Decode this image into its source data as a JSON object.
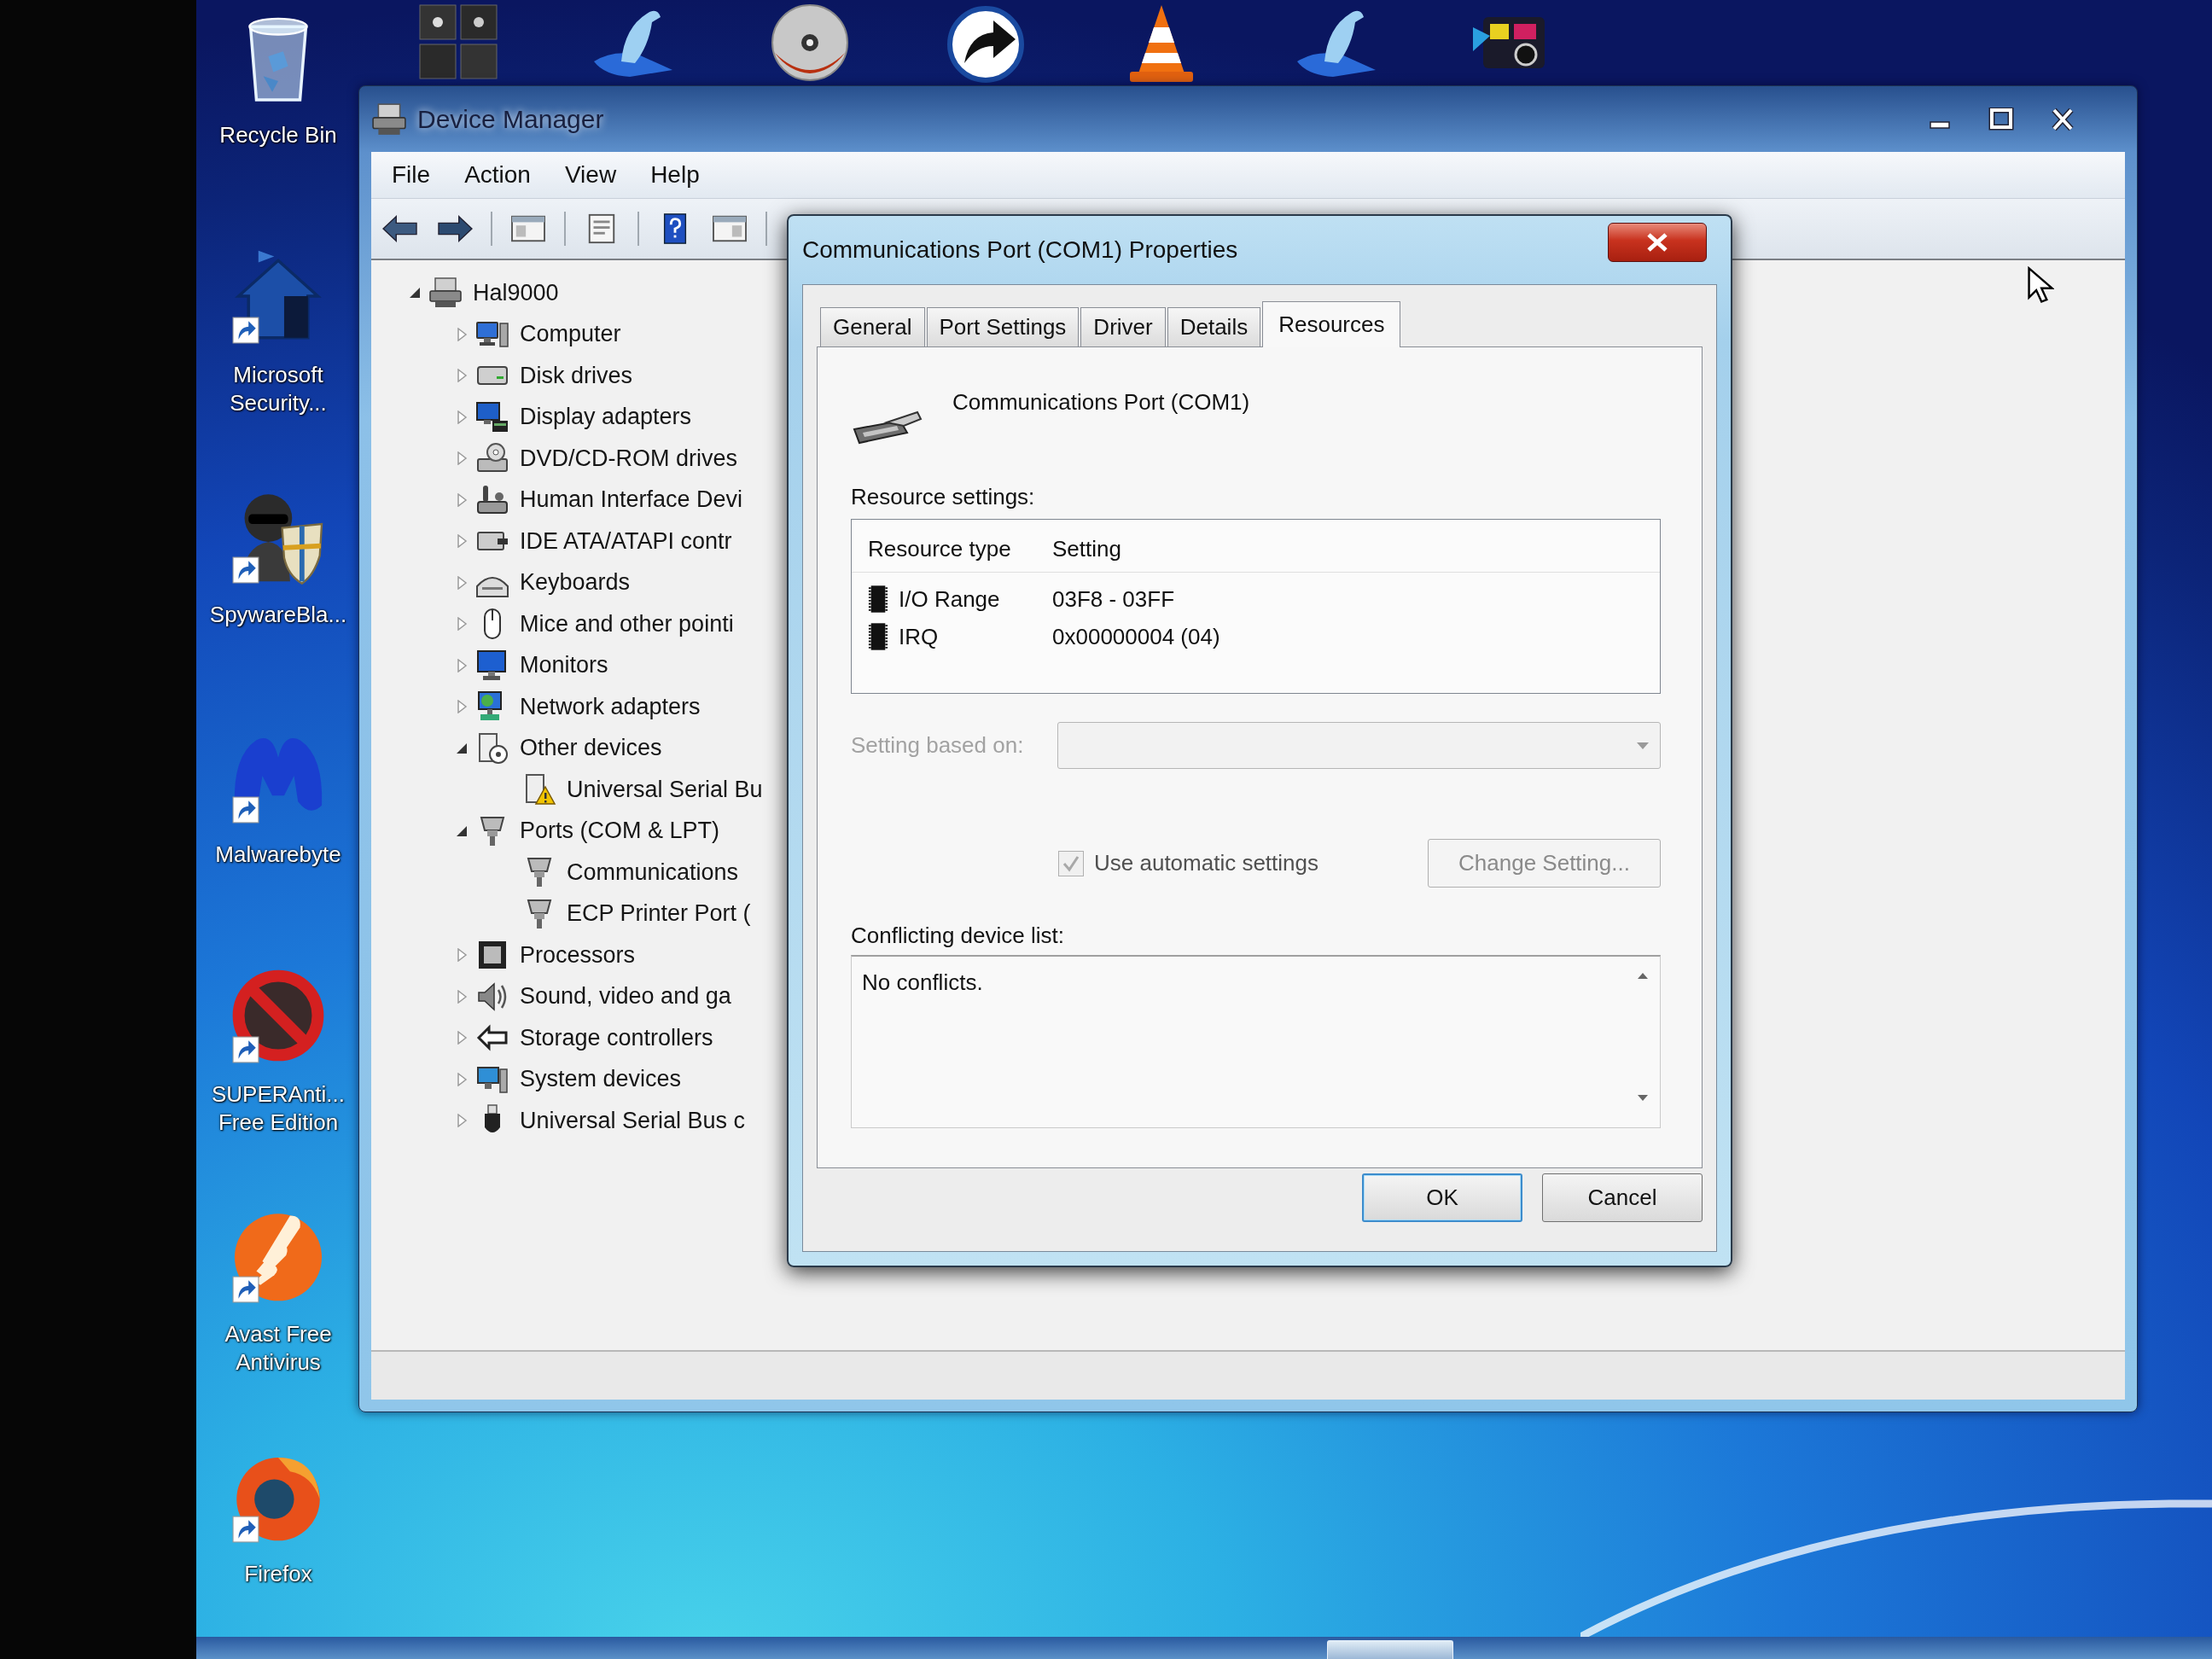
{
  "desktop": {
    "icons": [
      {
        "label": "Recycle Bin",
        "kind": "bin",
        "shortcut": false
      },
      {
        "label": "Microsoft Security...",
        "kind": "house",
        "shortcut": true
      },
      {
        "label": "SpywareBla...",
        "kind": "agent",
        "shortcut": true
      },
      {
        "label": "Malwarebyte",
        "kind": "m-logo",
        "shortcut": true
      },
      {
        "label": "SUPERAnti... Free Edition",
        "kind": "no-sign",
        "shortcut": true
      },
      {
        "label": "Avast Free Antivirus",
        "kind": "rays",
        "shortcut": true
      },
      {
        "label": "Firefox",
        "kind": "fox",
        "shortcut": true
      }
    ],
    "top_icons": [
      {
        "kind": "tiles"
      },
      {
        "kind": "bird"
      },
      {
        "kind": "disc"
      },
      {
        "kind": "arrow"
      },
      {
        "kind": "cone"
      },
      {
        "kind": "bird"
      },
      {
        "kind": "media"
      }
    ]
  },
  "device_manager": {
    "title": "Device Manager",
    "menu": [
      "File",
      "Action",
      "View",
      "Help"
    ],
    "toolbar": [
      {
        "kind": "back"
      },
      {
        "kind": "forward"
      },
      {
        "kind": "separator"
      },
      {
        "kind": "tree-pane"
      },
      {
        "kind": "separator"
      },
      {
        "kind": "properties"
      },
      {
        "kind": "separator"
      },
      {
        "kind": "help"
      },
      {
        "kind": "action-pane"
      },
      {
        "kind": "separator"
      }
    ],
    "tree": {
      "label": "Hal9000",
      "kind": "host",
      "expanded": true,
      "children": [
        {
          "label": "Computer",
          "kind": "computer",
          "expanded": false
        },
        {
          "label": "Disk drives",
          "kind": "disk",
          "expanded": false
        },
        {
          "label": "Display adapters",
          "kind": "display",
          "expanded": false
        },
        {
          "label": "DVD/CD-ROM drives",
          "kind": "dvd",
          "expanded": false
        },
        {
          "label": "Human Interface Devi",
          "kind": "hid",
          "expanded": false
        },
        {
          "label": "IDE ATA/ATAPI contr",
          "kind": "ide",
          "expanded": false
        },
        {
          "label": "Keyboards",
          "kind": "keyboard",
          "expanded": false
        },
        {
          "label": "Mice and other pointi",
          "kind": "mouse",
          "expanded": false
        },
        {
          "label": "Monitors",
          "kind": "monitor",
          "expanded": false
        },
        {
          "label": "Network adapters",
          "kind": "network",
          "expanded": false
        },
        {
          "label": "Other devices",
          "kind": "unknown",
          "expanded": true,
          "children": [
            {
              "label": "Universal Serial Bu",
              "kind": "usb-warning"
            }
          ]
        },
        {
          "label": "Ports (COM & LPT)",
          "kind": "port",
          "expanded": true,
          "children": [
            {
              "label": "Communications",
              "kind": "port"
            },
            {
              "label": "ECP Printer Port (",
              "kind": "port"
            }
          ]
        },
        {
          "label": "Processors",
          "kind": "processor",
          "expanded": false
        },
        {
          "label": "Sound, video and ga",
          "kind": "sound",
          "expanded": false
        },
        {
          "label": "Storage controllers",
          "kind": "storage",
          "expanded": false
        },
        {
          "label": "System devices",
          "kind": "system",
          "expanded": false
        },
        {
          "label": "Universal Serial Bus c",
          "kind": "usb",
          "expanded": false
        }
      ]
    }
  },
  "dialog": {
    "title": "Communications Port (COM1) Properties",
    "tabs": [
      {
        "label": "General",
        "selected": false
      },
      {
        "label": "Port Settings",
        "selected": false
      },
      {
        "label": "Driver",
        "selected": false
      },
      {
        "label": "Details",
        "selected": false
      },
      {
        "label": "Resources",
        "selected": true
      }
    ],
    "device_name": "Communications Port (COM1)",
    "resource_settings": {
      "label": "Resource settings:",
      "columns": [
        "Resource type",
        "Setting"
      ],
      "rows": [
        {
          "type": "I/O Range",
          "setting": "03F8 - 03FF"
        },
        {
          "type": "IRQ",
          "setting": "0x00000004 (04)"
        }
      ]
    },
    "setting_based_on": {
      "label": "Setting based on:",
      "disabled": true
    },
    "automatic_settings": {
      "label": "Use automatic settings",
      "checked": true,
      "disabled": true
    },
    "change_setting": {
      "label": "Change Setting...",
      "disabled": true
    },
    "conflicts": {
      "label": "Conflicting device list:",
      "text": "No conflicts."
    },
    "buttons": [
      {
        "label": "OK",
        "default": true
      },
      {
        "label": "Cancel",
        "default": false
      }
    ]
  }
}
